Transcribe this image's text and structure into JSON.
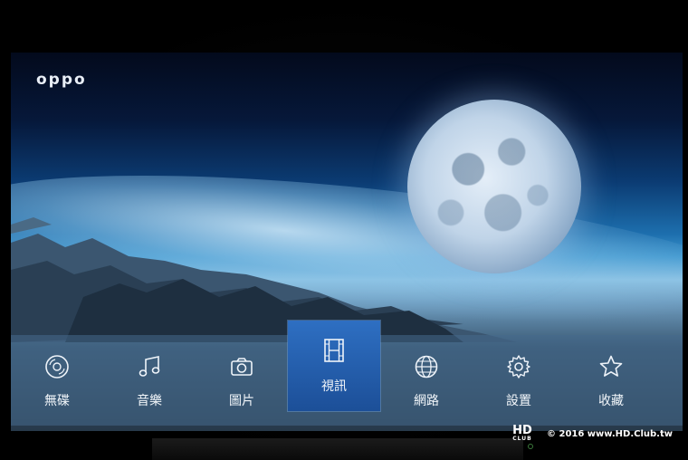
{
  "brand": {
    "logo_text": "oppo"
  },
  "menu": {
    "items": [
      {
        "id": "disc",
        "label": "無碟",
        "icon": "disc-icon"
      },
      {
        "id": "music",
        "label": "音樂",
        "icon": "music-note-icon"
      },
      {
        "id": "photo",
        "label": "圖片",
        "icon": "camera-icon"
      },
      {
        "id": "video",
        "label": "視訊",
        "icon": "film-icon",
        "selected": true
      },
      {
        "id": "network",
        "label": "網路",
        "icon": "globe-icon"
      },
      {
        "id": "settings",
        "label": "設置",
        "icon": "gear-icon"
      },
      {
        "id": "favorites",
        "label": "收藏",
        "icon": "star-icon"
      }
    ]
  },
  "watermark": {
    "logo_top": "HD",
    "logo_bottom": "CLUB",
    "copyright": "© 2016  www.HD.Club.tw"
  },
  "colors": {
    "selected": "#1f5aa8",
    "menu_bar": "#46698c"
  }
}
